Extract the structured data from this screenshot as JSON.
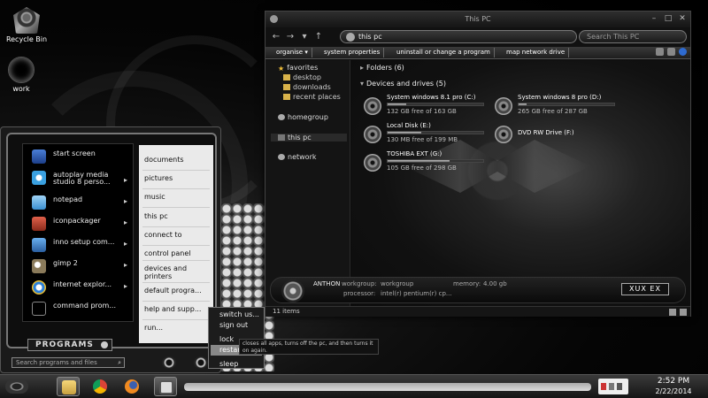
{
  "desktop": {
    "icons": [
      {
        "label": "Recycle Bin",
        "icon": "recycle-bin-icon"
      },
      {
        "label": "work",
        "icon": "user-folder-icon"
      }
    ]
  },
  "explorer": {
    "title": "This PC",
    "address": "this pc",
    "search_placeholder": "Search This PC",
    "commands": [
      "organise ▾",
      "system properties",
      "uninstall or change a program",
      "map network drive"
    ],
    "nav": {
      "favorites": "favorites",
      "favorite_items": [
        "desktop",
        "downloads",
        "recent places"
      ],
      "homegroup": "homegroup",
      "this_pc": "this pc",
      "network": "network"
    },
    "folders_header": "Folders (6)",
    "drives_header": "Devices and drives (5)",
    "drives": [
      {
        "name": "System windows 8.1 pro (C:)",
        "free": "132 GB free of 163 GB",
        "used_fraction": 0.19
      },
      {
        "name": "System windows 8 pro (D:)",
        "free": "265 GB free of 287 GB",
        "used_fraction": 0.08
      },
      {
        "name": "Local Disk (E:)",
        "free": "130 MB free of 199 MB",
        "used_fraction": 0.35
      },
      {
        "name": "DVD RW Drive (F:)",
        "free": "",
        "used_fraction": null
      },
      {
        "name": "TOSHIBA EXT (G:)",
        "free": "105 GB free of 298 GB",
        "used_fraction": 0.65
      }
    ],
    "details": {
      "computer_name": "ANTHON",
      "workgroup_label": "workgroup:",
      "workgroup_value": "workgroup",
      "memory_label": "memory:",
      "memory_value": "4.00 gb",
      "processor_label": "processor:",
      "processor_value": "intel(r) pentium(r) cp...",
      "logo": "XUX EX"
    },
    "status": "11 items"
  },
  "start_menu": {
    "programs": [
      {
        "label": "start screen",
        "icon": "start-screen-icon",
        "arrow": ""
      },
      {
        "label": "autoplay media studio 8 perso...",
        "icon": "autoplay-icon",
        "arrow": "▸"
      },
      {
        "label": "notepad",
        "icon": "notepad-icon",
        "arrow": "▸"
      },
      {
        "label": "iconpackager",
        "icon": "iconpackager-icon",
        "arrow": "▸"
      },
      {
        "label": "inno setup com...",
        "icon": "inno-setup-icon",
        "arrow": "▸"
      },
      {
        "label": "gimp 2",
        "icon": "gimp-icon",
        "arrow": "▸"
      },
      {
        "label": "internet explor...",
        "icon": "internet-explorer-icon",
        "arrow": "▸"
      },
      {
        "label": "command prom...",
        "icon": "command-prompt-icon",
        "arrow": ""
      }
    ],
    "right_items": [
      "documents",
      "pictures",
      "music",
      "this pc",
      "connect to",
      "control panel",
      "devices and printers",
      "default progra...",
      "help and supp...",
      "run..."
    ],
    "programs_label": "PROGRAMS",
    "search_placeholder": "Search programs and files",
    "shutdown_options": [
      "switch us...",
      "sign out",
      "lock",
      "restart",
      "sleep"
    ],
    "tooltip": "closes all apps, turns off the pc, and then turns it on again."
  },
  "taskbar": {
    "apps": [
      "file-explorer-icon",
      "chrome-icon",
      "firefox-icon",
      "window-app-icon"
    ],
    "time": "2:52 PM",
    "date": "2/22/2014"
  },
  "colors": {
    "accent": "#2e6bd1",
    "folder": "#d8b24a",
    "drive_bar": "#999999"
  }
}
